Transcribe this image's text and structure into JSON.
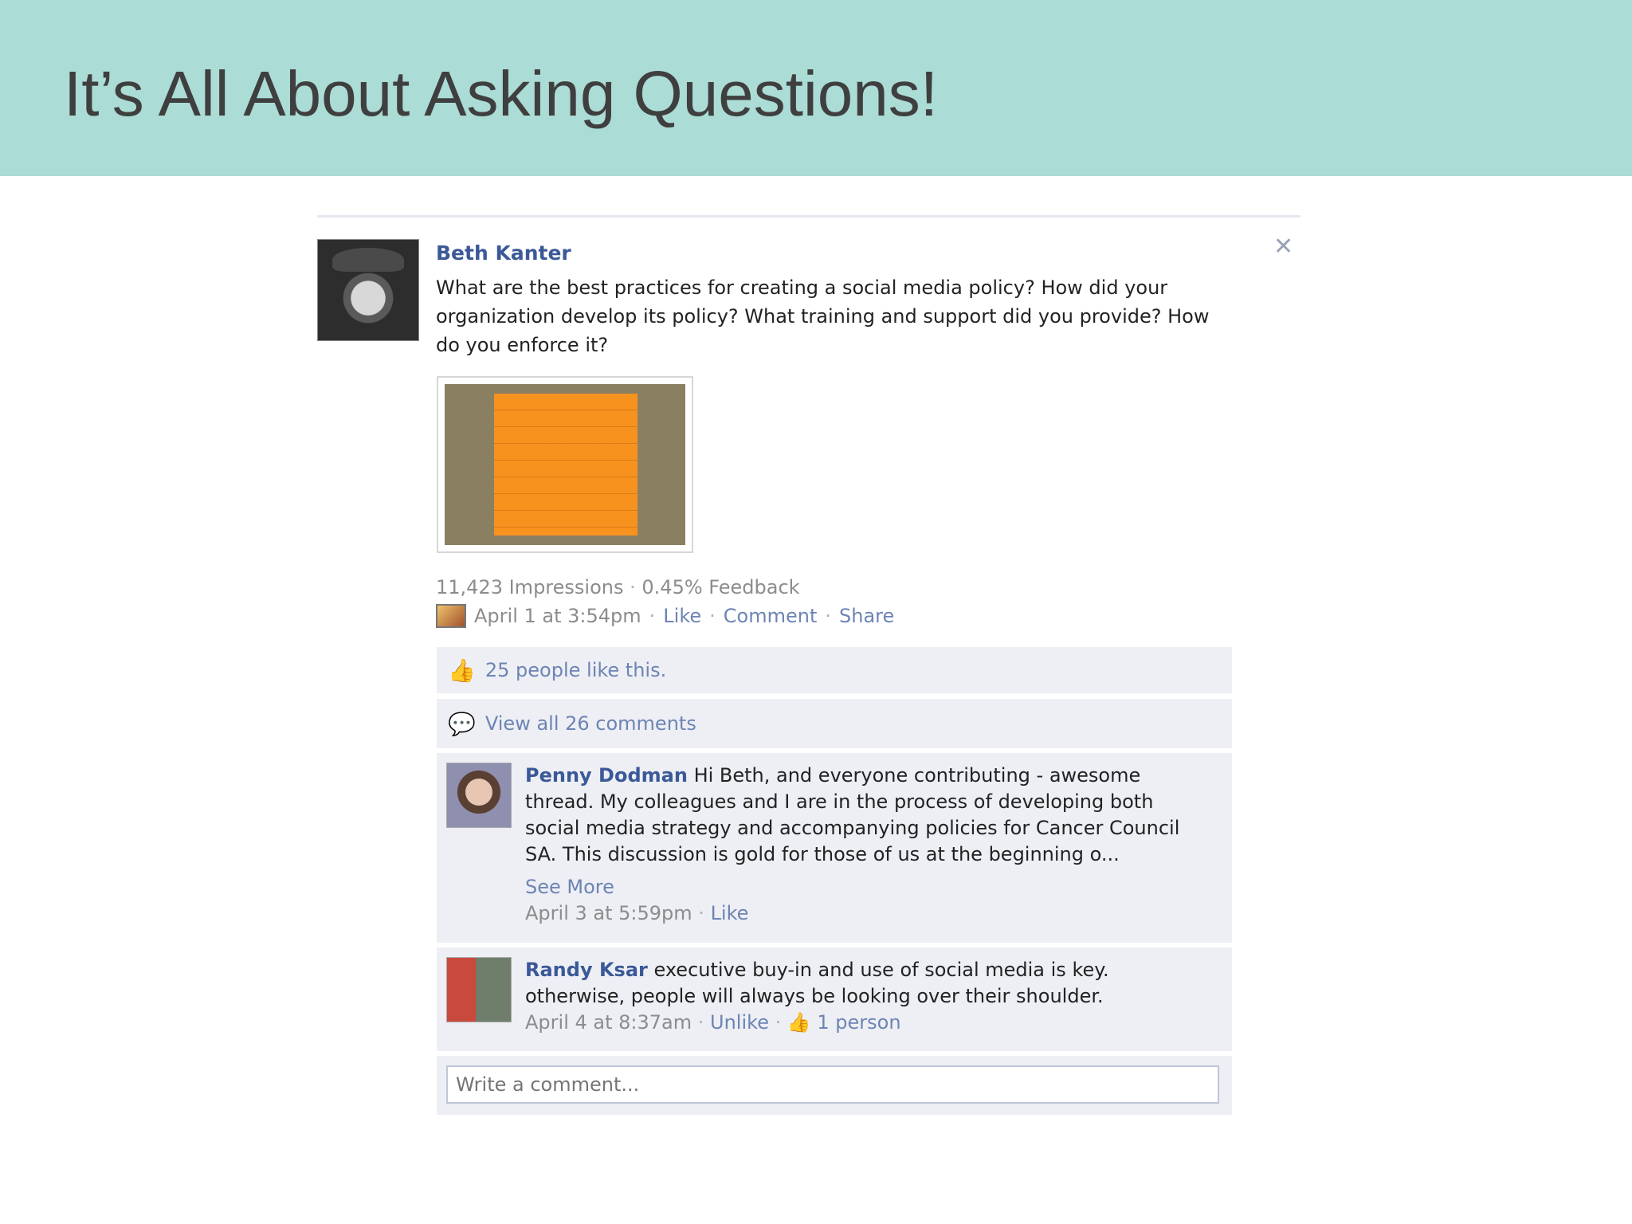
{
  "slide": {
    "title": "It’s All About Asking Questions!"
  },
  "post": {
    "author": "Beth Kanter",
    "question": "What are the best practices for creating a social media policy? How did your organization develop its policy? What training and support did you provide? How do you enforce it?",
    "close_symbol": "✕",
    "impressions": "11,423 Impressions",
    "feedback": "0.45% Feedback",
    "date": "April 1 at 3:54pm",
    "actions": {
      "like": "Like",
      "comment": "Comment",
      "share": "Share"
    },
    "separator": "·",
    "likes_text": "25 people like this.",
    "view_comments": "View all 26 comments",
    "thumb_symbol": "👍",
    "bubble_symbol": "💬"
  },
  "comments": [
    {
      "name": "Penny Dodman",
      "text": "Hi Beth, and everyone contributing - awesome thread. My colleagues and I are in the process of developing both social media strategy and accompanying policies for Cancer Council SA. This discussion is gold for those of us at the beginning o...",
      "see_more": "See More",
      "date": "April 3 at 5:59pm",
      "like": "Like"
    },
    {
      "name": "Randy Ksar",
      "text": "executive buy-in and use of social media is key. otherwise, people will always be looking over their shoulder.",
      "date": "April 4 at 8:37am",
      "unlike": "Unlike",
      "likes": "1 person"
    }
  ],
  "write_comment": {
    "placeholder": "Write a comment..."
  },
  "icons": [
    "close-icon",
    "photo-icon",
    "thumbs-up-icon",
    "comment-bubble-icon"
  ]
}
